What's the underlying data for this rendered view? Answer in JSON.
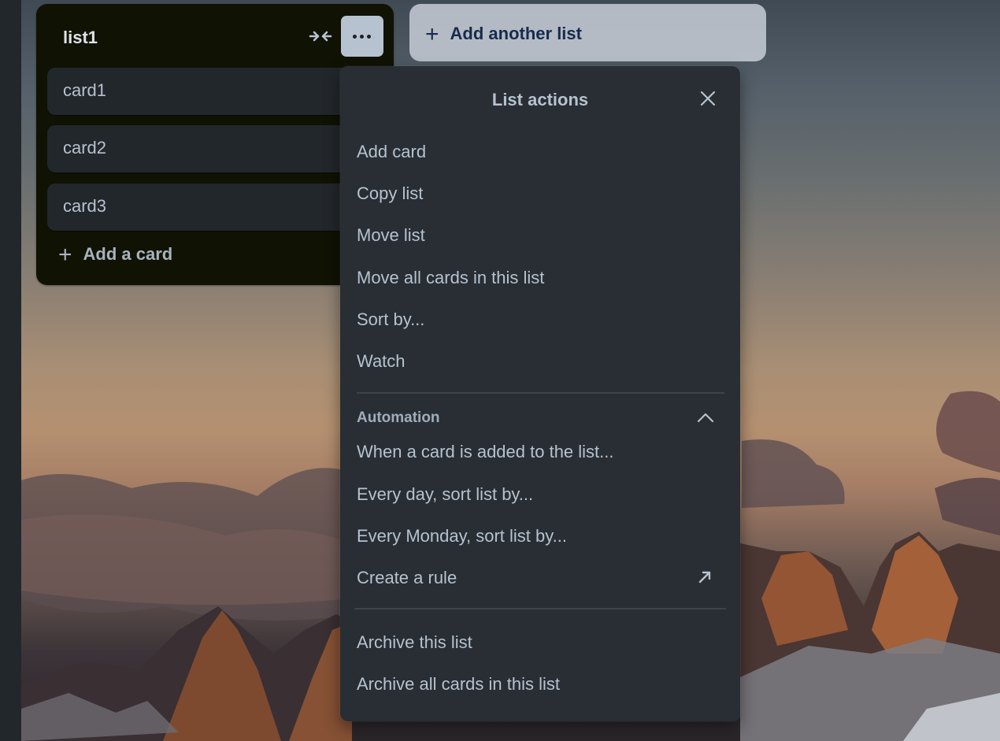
{
  "list": {
    "title": "list1",
    "cards": [
      "card1",
      "card2",
      "card3"
    ],
    "add_card_label": "Add a card",
    "add_card_icon": "plus-icon",
    "collapse_icon": "collapse-arrows-icon",
    "more_icon": "ellipsis-icon"
  },
  "add_list": {
    "label": "Add another list",
    "icon": "plus-icon"
  },
  "list_actions": {
    "title": "List actions",
    "close_icon": "close-icon",
    "items": [
      "Add card",
      "Copy list",
      "Move list",
      "Move all cards in this list",
      "Sort by...",
      "Watch"
    ],
    "automation": {
      "label": "Automation",
      "toggle_icon": "chevron-up-icon",
      "items": [
        "When a card is added to the list...",
        "Every day, sort list by...",
        "Every Monday, sort list by...",
        "Create a rule"
      ],
      "create_rule_icon": "external-link-icon"
    },
    "archive_items": [
      "Archive this list",
      "Archive all cards in this list"
    ]
  },
  "colors": {
    "list_bg": "#101204",
    "card_bg": "#22272b",
    "popover_bg": "#282e33",
    "text": "#b6c2cf",
    "more_button_bg": "#b6c2cf"
  }
}
